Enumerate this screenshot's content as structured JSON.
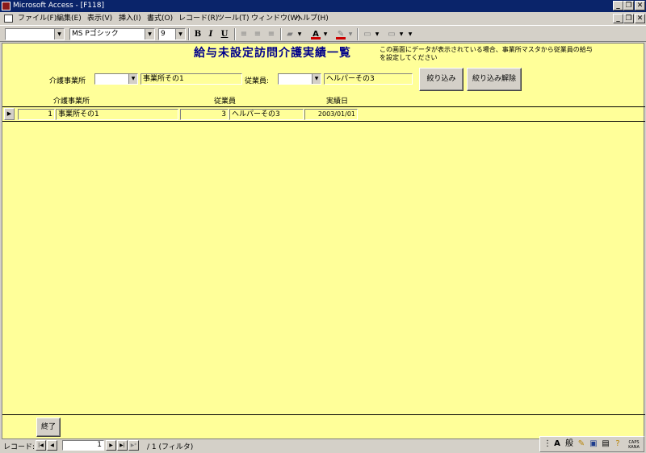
{
  "window": {
    "title": "Microsoft Access - [F118]",
    "min_glyph": "_",
    "restore_glyph": "❐",
    "close_glyph": "✕"
  },
  "menu": {
    "items": [
      "ファイル(F)",
      "編集(E)",
      "表示(V)",
      "挿入(I)",
      "書式(O)",
      "レコード(R)",
      "ツール(T)",
      "ウィンドウ(W)",
      "ヘルプ(H)"
    ]
  },
  "toolbar": {
    "object_combo": "",
    "font_name": "MS Pゴシック",
    "font_size": "9",
    "bold": "B",
    "italic": "I",
    "underline": "U",
    "font_color": "#cc0000",
    "line_color": "#cc0000"
  },
  "form": {
    "title": "給与未設定訪問介護実績一覧",
    "note": "この画面にデータが表示されている場合、事業所マスタから従業員の給与を設定してください",
    "filter": {
      "office_label": "介護事業所",
      "office_value": "事業所その1",
      "employee_label": "従業員:",
      "employee_value": "ヘルパーその3",
      "filter_button": "絞り込み",
      "clear_button": "絞り込み解除"
    },
    "columns": {
      "office": "介護事業所",
      "employee": "従業員",
      "date": "実績日"
    },
    "record": {
      "office_id": "1",
      "office_name": "事業所その1",
      "employee_id": "3",
      "employee_name": "ヘルパーその3",
      "date": "2003/01/01",
      "selector_glyph": "▶"
    },
    "close_button": "終了"
  },
  "navigation": {
    "label": "レコード:",
    "current": "1",
    "total": "/ 1 (フィルタ)"
  },
  "colors": {
    "form_background": "#ffff99",
    "title_color": "#00008b",
    "titlebar": "#0a246a",
    "chrome": "#d4d0c8"
  }
}
